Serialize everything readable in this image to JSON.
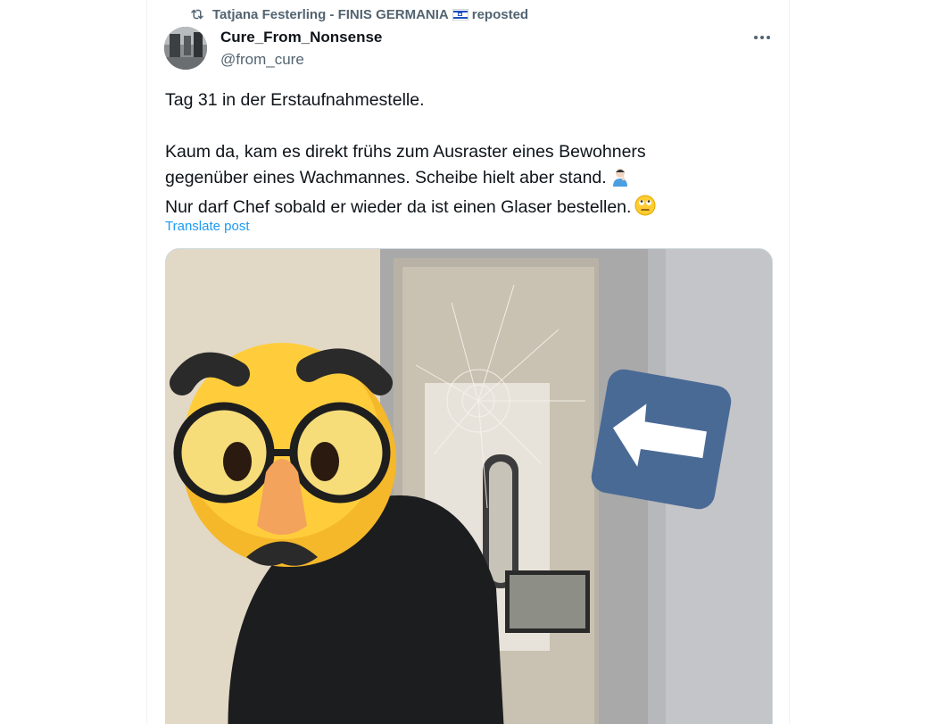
{
  "repost": {
    "icon": "repost-icon",
    "user": "Tatjana Festerling - FINIS GERMANIA",
    "flag": "israel-flag-icon",
    "action": "reposted"
  },
  "author": {
    "name": "Cure_From_Nonsense",
    "handle": "@from_cure"
  },
  "post": {
    "line1": "Tag 31 in der Erstaufnahmestelle.",
    "line2": "Kaum da, kam es direkt frühs zum Ausraster eines Bewohners",
    "line3": "gegenüber eines Wachmannes. Scheibe hielt aber stand.",
    "line3_emoji": "man-facepalming-emoji",
    "line4": "Nur darf Chef sobald er wieder da ist einen Glaser bestellen.",
    "line4_emoji": "face-with-rolling-eyes-emoji",
    "translate_label": "Translate post"
  },
  "media": {
    "icons": [
      "disguised-face-sticker",
      "left-arrow-sticker"
    ]
  },
  "colors": {
    "text": "#0f1419",
    "secondary": "#536471",
    "link": "#1d9bf0",
    "border": "#eff3f4"
  }
}
